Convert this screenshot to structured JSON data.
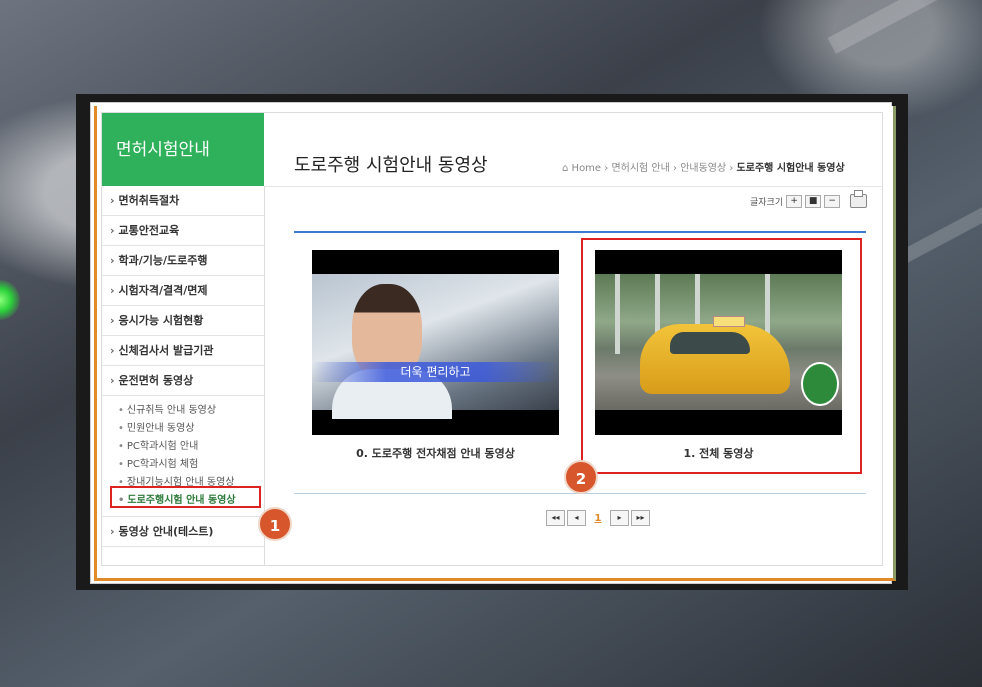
{
  "sidebar": {
    "title": "면허시험안내",
    "items": [
      {
        "label": "면허취득절차"
      },
      {
        "label": "교통안전교육"
      },
      {
        "label": "학과/기능/도로주행"
      },
      {
        "label": "시험자격/결격/면제"
      },
      {
        "label": "응시가능 시험현황"
      },
      {
        "label": "신체검사서 발급기관"
      },
      {
        "label": "운전면허 동영상"
      }
    ],
    "sub_items": [
      {
        "label": "신규취득 안내 동영상"
      },
      {
        "label": "민원안내 동영상"
      },
      {
        "label": "PC학과시험 안내"
      },
      {
        "label": "PC학과시험 체험"
      },
      {
        "label": "장내기능시험 안내 동영상"
      },
      {
        "label": "도로주행시험 안내 동영상"
      }
    ],
    "last_item": {
      "label": "동영상 안내(테스트)"
    }
  },
  "header": {
    "title": "도로주행 시험안내 동영상",
    "breadcrumb": {
      "home": "Home",
      "level1": "면허시험 안내",
      "level2": "안내동영상",
      "current": "도로주행 시험안내 동영상"
    }
  },
  "toolbar": {
    "font_size_label": "글자크기",
    "increase": "+",
    "reset": "■",
    "decrease": "−"
  },
  "videos": [
    {
      "title": "0. 도로주행 전자채점 안내 동영상",
      "overlay_text": "더욱 편리하고"
    },
    {
      "title": "1. 전체 동영상"
    }
  ],
  "pagination": {
    "first": "◂◂",
    "prev": "◂",
    "current_page": "1",
    "next": "▸",
    "last": "▸▸"
  },
  "annotations": {
    "badge1": "1",
    "badge2": "2"
  }
}
